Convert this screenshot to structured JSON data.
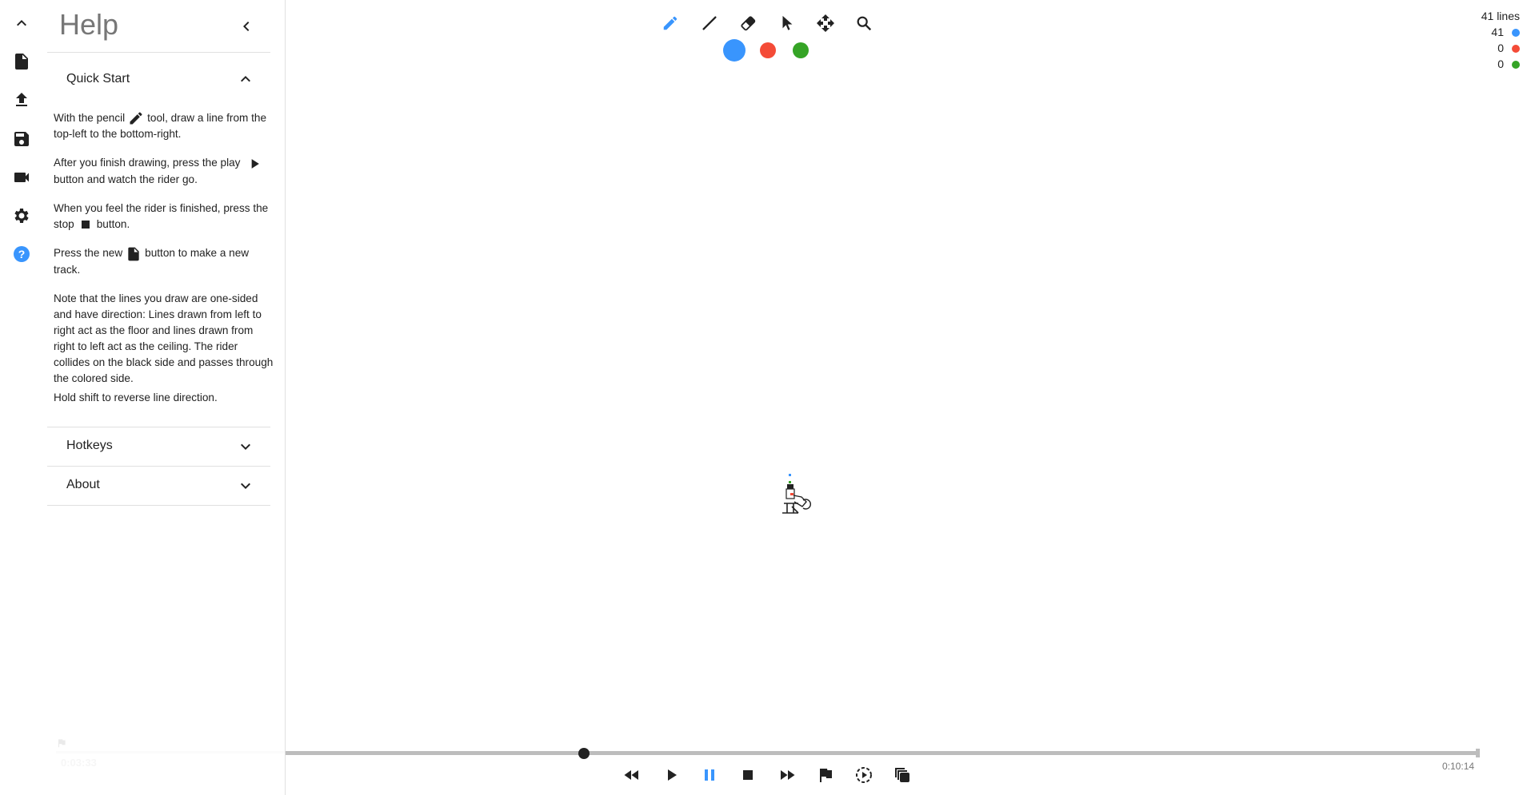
{
  "sidebar": {
    "icons": [
      "chevron-up-icon",
      "new-file-icon",
      "upload-icon",
      "save-icon",
      "video-camera-icon",
      "settings-gear-icon",
      "help-icon"
    ]
  },
  "help": {
    "title": "Help",
    "quick_start": {
      "label": "Quick Start",
      "p1a": "With the pencil",
      "p1b": "tool, draw a line from the top-left to the bottom-right.",
      "p2a": "After you finish drawing, press the play",
      "p2b": "button and watch the rider go.",
      "p3a": "When you feel the rider is finished, press the stop",
      "p3b": "button.",
      "p4a": "Press the new",
      "p4b": "button to make a new track.",
      "p5": "Note that the lines you draw are one-sided and have direction: Lines drawn from left to right act as the floor and lines drawn from right to left act as the ceiling. The rider collides on the black side and passes through the colored side.",
      "p6": "Hold shift to reverse line direction."
    },
    "hotkeys_label": "Hotkeys",
    "about_label": "About"
  },
  "toolbar": {
    "tools": [
      "pencil",
      "line",
      "eraser",
      "select",
      "pan",
      "zoom"
    ],
    "active_tool": "pencil",
    "colors": {
      "blue": "#3995fd",
      "red": "#f44b37",
      "green": "#35a426"
    },
    "selected_color": "blue"
  },
  "stats": {
    "total": "41 lines",
    "blue": "41",
    "red": "0",
    "green": "0"
  },
  "timeline": {
    "end_time": "0:10:14",
    "flag_time": "0:03:33",
    "progress_percent": 25
  },
  "playback": {
    "buttons": [
      "rewind",
      "play",
      "pause",
      "stop",
      "fast-forward",
      "flag",
      "play-from-flag",
      "onion-skin"
    ],
    "active": "pause"
  },
  "accent": "#3995fd"
}
